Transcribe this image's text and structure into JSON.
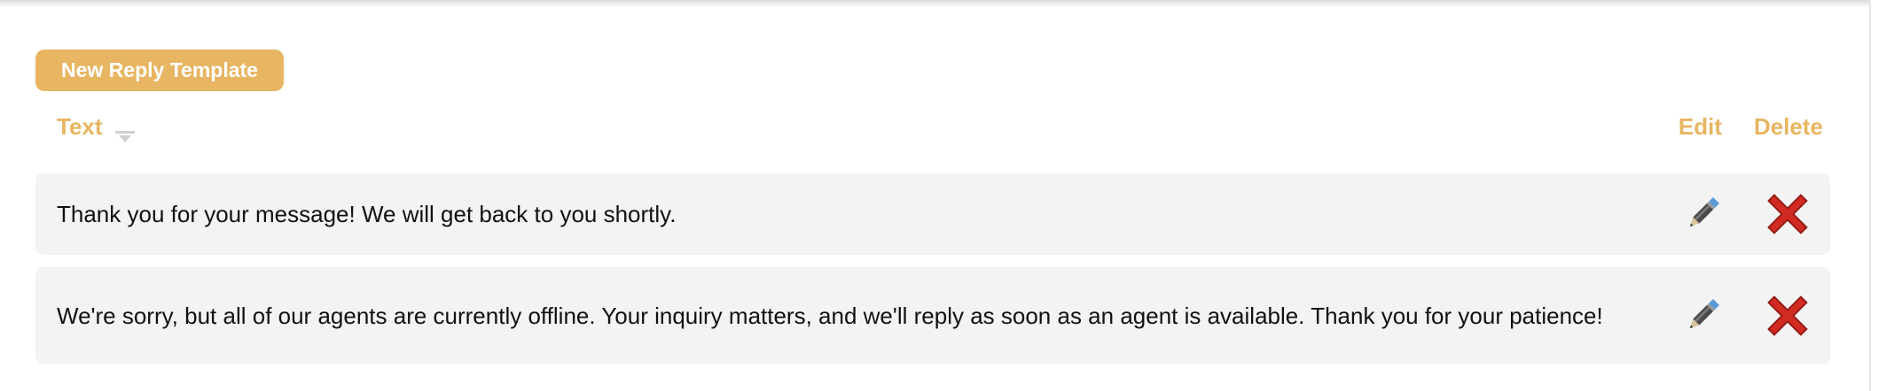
{
  "toolbar": {
    "new_template_label": "New Reply Template"
  },
  "table": {
    "headers": {
      "text": "Text",
      "edit": "Edit",
      "delete": "Delete"
    },
    "sort_icon": "sort-down-icon",
    "rows": [
      {
        "text": "Thank you for your message! We will get back to you shortly.",
        "edit_icon": "pencil-icon",
        "delete_icon": "red-x-icon"
      },
      {
        "text": "We're sorry, but all of our agents are currently offline. Your inquiry matters, and we'll reply as soon as an agent is available. Thank you for your patience!",
        "edit_icon": "pencil-icon",
        "delete_icon": "red-x-icon"
      }
    ]
  },
  "colors": {
    "accent": "#e8b562",
    "row_bg": "#f3f3f3",
    "delete": "#c8211b",
    "text": "#111111"
  }
}
